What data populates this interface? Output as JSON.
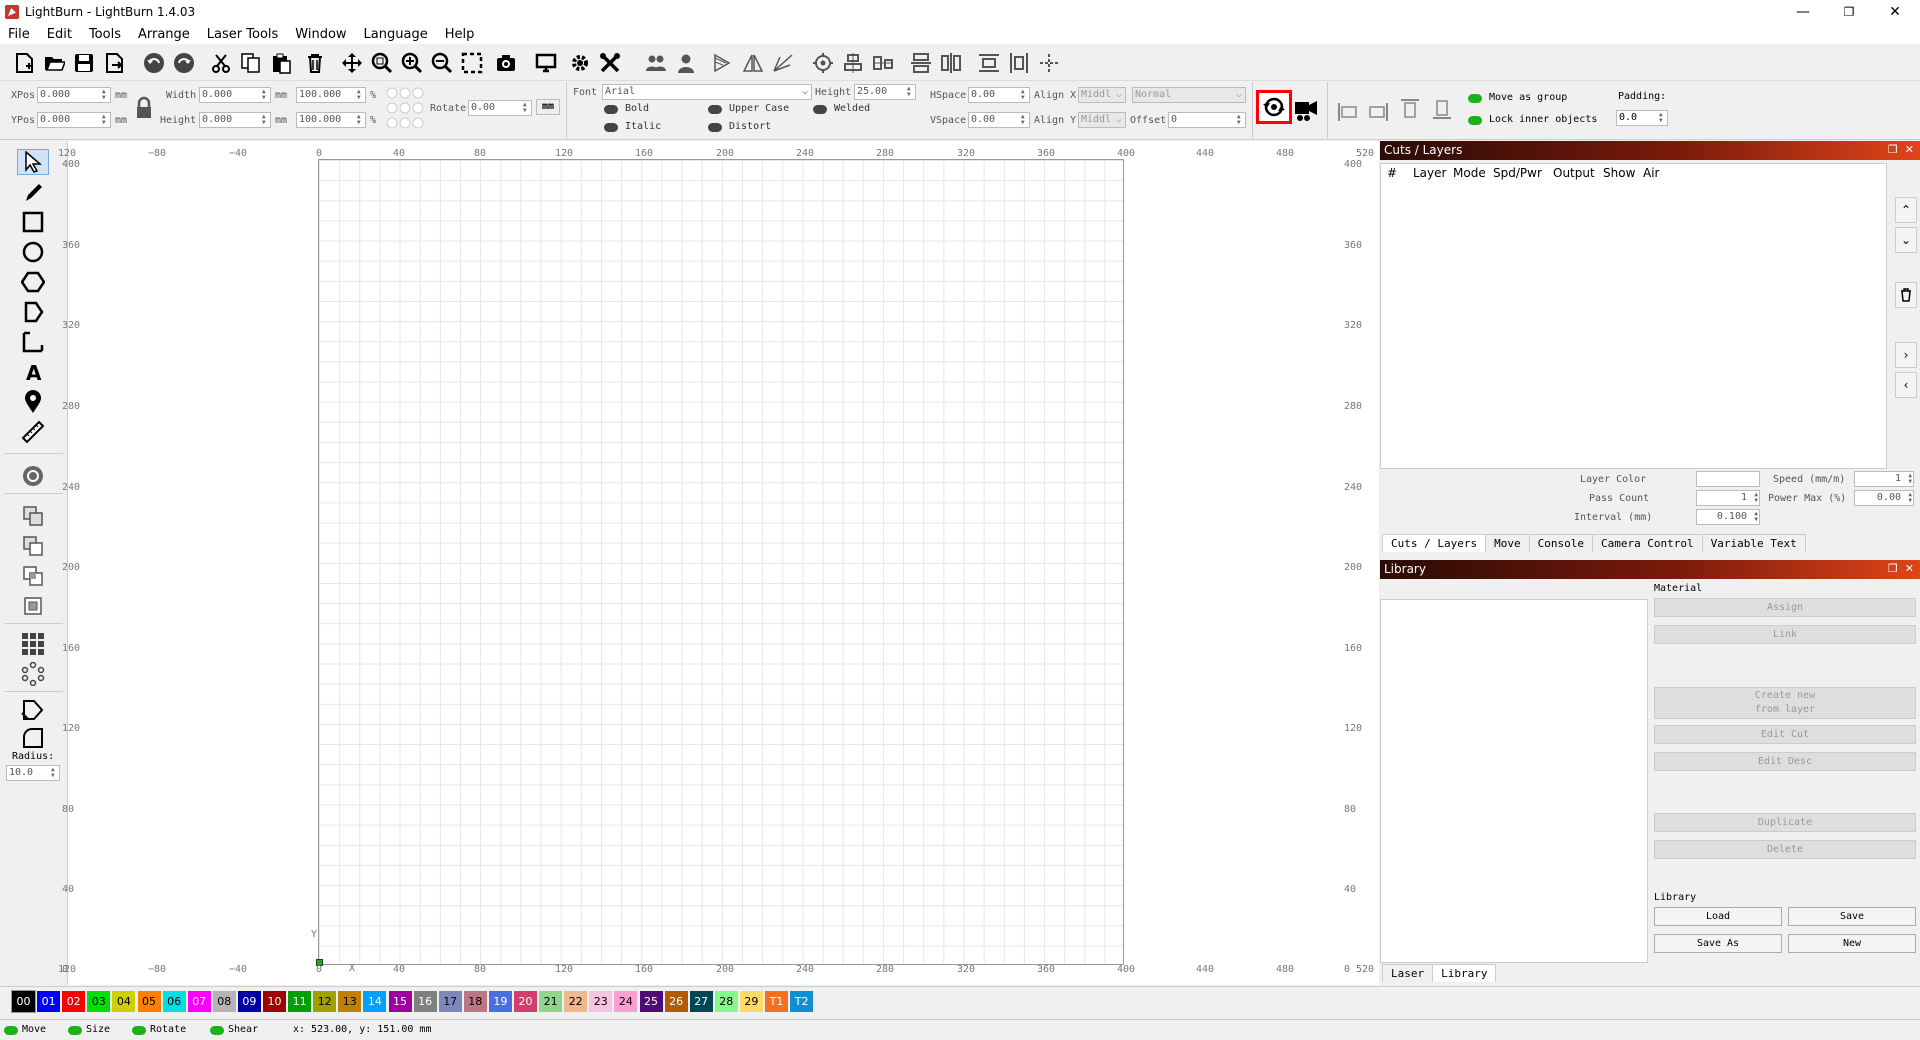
{
  "window": {
    "title": "LightBurn - LightBurn 1.4.03",
    "minimize": "—",
    "restore": "❐",
    "close": "✕"
  },
  "menu": [
    "File",
    "Edit",
    "Tools",
    "Arrange",
    "Laser Tools",
    "Window",
    "Language",
    "Help"
  ],
  "toolbar_icons": [
    "new-file",
    "open-file",
    "save",
    "save-as",
    "undo",
    "redo",
    "cut",
    "copy",
    "paste",
    "delete",
    "move",
    "zoom-frame",
    "zoom-in",
    "zoom-out",
    "zoom-selection",
    "camera-capture",
    "display",
    "settings",
    "tools",
    "group",
    "user",
    "mirror-h",
    "mirror-v",
    "path",
    "center",
    "align-a",
    "align-b",
    "align-c",
    "align-d",
    "align-e",
    "align-f",
    "align-g"
  ],
  "props": {
    "xpos_label": "XPos",
    "xpos": "0.000",
    "ypos_label": "YPos",
    "ypos": "0.000",
    "mm": "mm",
    "width_label": "Width",
    "width": "0.000",
    "height_label": "Height",
    "height": "0.000",
    "w_pct": "100.000",
    "h_pct": "100.000",
    "pct": "%",
    "rotate_label": "Rotate",
    "rotate": "0.00",
    "units_btn": "mm",
    "font_label": "Font",
    "font": "Arial",
    "fheight_label": "Height",
    "fheight": "25.00",
    "hspace_label": "HSpace",
    "hspace": "0.00",
    "vspace_label": "VSpace",
    "vspace": "0.00",
    "alignx_label": "Align X",
    "alignx": "Middl",
    "aligny_label": "Align Y",
    "aligny": "Middl",
    "style": "Normal",
    "offset_label": "Offset",
    "offset": "0",
    "bold": "Bold",
    "italic": "Italic",
    "upper": "Upper Case",
    "distort": "Distort",
    "welded": "Welded",
    "move_group": "Move as group",
    "lock_inner": "Lock inner objects",
    "padding_label": "Padding:",
    "padding": "0.0"
  },
  "ruler": {
    "top": [
      "120",
      "−80",
      "−40",
      "0",
      "40",
      "80",
      "120",
      "160",
      "200",
      "240",
      "280",
      "320",
      "360",
      "400",
      "440",
      "480",
      "520"
    ],
    "left": [
      "400",
      "360",
      "320",
      "280",
      "240",
      "200",
      "160",
      "120",
      "80",
      "40",
      "0"
    ],
    "bottom": [
      "120",
      "−80",
      "−40",
      "0",
      "40",
      "80",
      "120",
      "160",
      "200",
      "240",
      "280",
      "320",
      "360",
      "400",
      "440",
      "480",
      "520"
    ],
    "x_axis": "X",
    "y_axis": "Y"
  },
  "left_tools": {
    "radius_label": "Radius:",
    "radius": "10.0"
  },
  "cuts": {
    "title": "Cuts / Layers",
    "columns": [
      "#",
      "Layer",
      "Mode",
      "Spd/Pwr",
      "Output",
      "Show",
      "Air"
    ],
    "layer_color": "Layer Color",
    "speed": "Speed (mm/m)",
    "speed_val": "1",
    "pass_count": "Pass Count",
    "pass_val": "1",
    "power_max": "Power Max (%)",
    "power_val": "0.00",
    "interval": "Interval (mm)",
    "interval_val": "0.100",
    "tabs": [
      "Cuts / Layers",
      "Move",
      "Console",
      "Camera Control",
      "Variable Text"
    ]
  },
  "library": {
    "title": "Library",
    "material": "Material",
    "buttons": [
      "Assign",
      "Link",
      "Create new from layer",
      "Edit Cut",
      "Edit Desc",
      "Duplicate",
      "Delete"
    ],
    "library_label": "Library",
    "load": "Load",
    "save": "Save",
    "save_as": "Save As",
    "new": "New",
    "tabs": [
      "Laser",
      "Library"
    ]
  },
  "palette": [
    {
      "label": "00",
      "color": "#000000",
      "text": "#ffffff"
    },
    {
      "label": "01",
      "color": "#0000ff",
      "text": "#ffffff"
    },
    {
      "label": "02",
      "color": "#ff0000",
      "text": "#ffffff"
    },
    {
      "label": "03",
      "color": "#00e000",
      "text": "#000000"
    },
    {
      "label": "04",
      "color": "#d0d000",
      "text": "#000000"
    },
    {
      "label": "05",
      "color": "#ff8000",
      "text": "#000000"
    },
    {
      "label": "06",
      "color": "#00e0e0",
      "text": "#000000"
    },
    {
      "label": "07",
      "color": "#ff00ff",
      "text": "#ffffff"
    },
    {
      "label": "08",
      "color": "#b4b4b4",
      "text": "#000000"
    },
    {
      "label": "09",
      "color": "#0000a0",
      "text": "#ffffff"
    },
    {
      "label": "10",
      "color": "#a00000",
      "text": "#ffffff"
    },
    {
      "label": "11",
      "color": "#00a000",
      "text": "#ffffff"
    },
    {
      "label": "12",
      "color": "#a0a000",
      "text": "#000000"
    },
    {
      "label": "13",
      "color": "#c08000",
      "text": "#000000"
    },
    {
      "label": "14",
      "color": "#00a0ff",
      "text": "#ffffff"
    },
    {
      "label": "15",
      "color": "#a000a0",
      "text": "#ffffff"
    },
    {
      "label": "16",
      "color": "#808080",
      "text": "#ffffff"
    },
    {
      "label": "17",
      "color": "#7d87b9",
      "text": "#000000"
    },
    {
      "label": "18",
      "color": "#bb7784",
      "text": "#000000"
    },
    {
      "label": "19",
      "color": "#4a6fe3",
      "text": "#ffffff"
    },
    {
      "label": "20",
      "color": "#d33f6a",
      "text": "#ffffff"
    },
    {
      "label": "21",
      "color": "#8cd78c",
      "text": "#000000"
    },
    {
      "label": "22",
      "color": "#f0b98d",
      "text": "#000000"
    },
    {
      "label": "23",
      "color": "#f6c4e1",
      "text": "#000000"
    },
    {
      "label": "24",
      "color": "#fa9ed4",
      "text": "#000000"
    },
    {
      "label": "25",
      "color": "#500a78",
      "text": "#ffffff"
    },
    {
      "label": "26",
      "color": "#b45a00",
      "text": "#ffffff"
    },
    {
      "label": "27",
      "color": "#004754",
      "text": "#ffffff"
    },
    {
      "label": "28",
      "color": "#86fa88",
      "text": "#000000"
    },
    {
      "label": "29",
      "color": "#ffdb66",
      "text": "#000000"
    },
    {
      "label": "T1",
      "color": "#f37020",
      "text": "#ffffff"
    },
    {
      "label": "T2",
      "color": "#0f8fd6",
      "text": "#ffffff"
    }
  ],
  "status": {
    "move": "Move",
    "size": "Size",
    "rotate": "Rotate",
    "shear": "Shear",
    "coords": "x: 523.00, y: 151.00 mm"
  },
  "highlight_color": "#ff0000"
}
